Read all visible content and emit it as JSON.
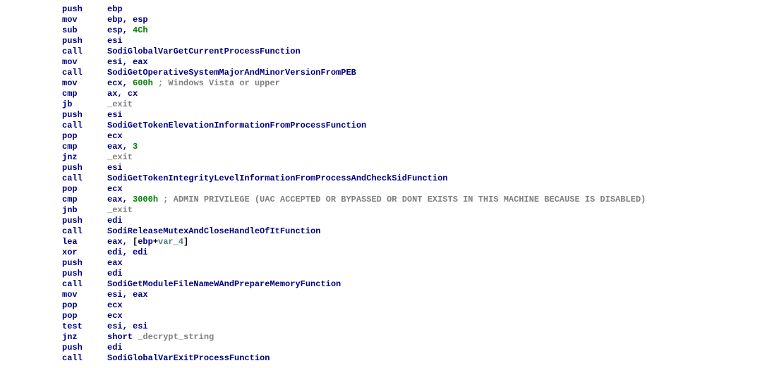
{
  "lines": [
    {
      "mn": "push",
      "ops": [
        {
          "t": "reg",
          "v": "ebp"
        }
      ]
    },
    {
      "mn": "mov",
      "ops": [
        {
          "t": "reg",
          "v": "ebp"
        },
        {
          "t": "reg",
          "v": "esp"
        }
      ]
    },
    {
      "mn": "sub",
      "ops": [
        {
          "t": "reg",
          "v": "esp"
        },
        {
          "t": "num",
          "v": "4Ch"
        }
      ]
    },
    {
      "mn": "push",
      "ops": [
        {
          "t": "reg",
          "v": "esi"
        }
      ]
    },
    {
      "mn": "call",
      "ops": [
        {
          "t": "reg",
          "v": "SodiGlobalVarGetCurrentProcessFunction"
        }
      ]
    },
    {
      "mn": "mov",
      "ops": [
        {
          "t": "reg",
          "v": "esi"
        },
        {
          "t": "reg",
          "v": "eax"
        }
      ]
    },
    {
      "mn": "call",
      "ops": [
        {
          "t": "reg",
          "v": "SodiGetOperativeSystemMajorAndMinorVersionFromPEB"
        }
      ]
    },
    {
      "mn": "mov",
      "ops": [
        {
          "t": "reg",
          "v": "ecx"
        },
        {
          "t": "num",
          "v": "600h"
        }
      ],
      "pad": "        ",
      "comment": "; Windows Vista or upper"
    },
    {
      "mn": "cmp",
      "ops": [
        {
          "t": "reg",
          "v": "ax"
        },
        {
          "t": "reg",
          "v": "cx"
        }
      ]
    },
    {
      "mn": "jb",
      "ops": [
        {
          "t": "lbl",
          "v": "_exit"
        }
      ]
    },
    {
      "mn": "push",
      "ops": [
        {
          "t": "reg",
          "v": "esi"
        }
      ]
    },
    {
      "mn": "call",
      "ops": [
        {
          "t": "reg",
          "v": "SodiGetTokenElevationInformationFromProcessFunction"
        }
      ]
    },
    {
      "mn": "pop",
      "ops": [
        {
          "t": "reg",
          "v": "ecx"
        }
      ]
    },
    {
      "mn": "cmp",
      "ops": [
        {
          "t": "reg",
          "v": "eax"
        },
        {
          "t": "num",
          "v": "3"
        }
      ]
    },
    {
      "mn": "jnz",
      "ops": [
        {
          "t": "lbl",
          "v": "_exit"
        }
      ]
    },
    {
      "mn": "push",
      "ops": [
        {
          "t": "reg",
          "v": "esi"
        }
      ]
    },
    {
      "mn": "call",
      "ops": [
        {
          "t": "reg",
          "v": "SodiGetTokenIntegrityLevelInformationFromProcessAndCheckSidFunction"
        }
      ]
    },
    {
      "mn": "pop",
      "ops": [
        {
          "t": "reg",
          "v": "ecx"
        }
      ]
    },
    {
      "mn": "cmp",
      "ops": [
        {
          "t": "reg",
          "v": "eax"
        },
        {
          "t": "num",
          "v": "3000h"
        }
      ],
      "pad": "       ",
      "comment": "; ADMIN PRIVILEGE (UAC ACCEPTED OR BYPASSED OR DONT EXISTS IN THIS MACHINE BECAUSE IS DISABLED)"
    },
    {
      "mn": "jnb",
      "ops": [
        {
          "t": "lbl",
          "v": "_exit"
        }
      ]
    },
    {
      "mn": "push",
      "ops": [
        {
          "t": "reg",
          "v": "edi"
        }
      ]
    },
    {
      "mn": "call",
      "ops": [
        {
          "t": "reg",
          "v": "SodiReleaseMutexAndCloseHandleOfItFunction"
        }
      ]
    },
    {
      "mn": "lea",
      "ops": [
        {
          "t": "reg",
          "v": "eax"
        },
        {
          "t": "mem",
          "parts": [
            {
              "t": "brk",
              "v": "["
            },
            {
              "t": "reg",
              "v": "ebp"
            },
            {
              "t": "brk",
              "v": "+"
            },
            {
              "t": "var",
              "v": "var_4"
            },
            {
              "t": "brk",
              "v": "]"
            }
          ]
        }
      ]
    },
    {
      "mn": "xor",
      "ops": [
        {
          "t": "reg",
          "v": "edi"
        },
        {
          "t": "reg",
          "v": "edi"
        }
      ]
    },
    {
      "mn": "push",
      "ops": [
        {
          "t": "reg",
          "v": "eax"
        }
      ]
    },
    {
      "mn": "push",
      "ops": [
        {
          "t": "reg",
          "v": "edi"
        }
      ]
    },
    {
      "mn": "call",
      "ops": [
        {
          "t": "reg",
          "v": "SodiGetModuleFileNameWAndPrepareMemoryFunction"
        }
      ]
    },
    {
      "mn": "mov",
      "ops": [
        {
          "t": "reg",
          "v": "esi"
        },
        {
          "t": "reg",
          "v": "eax"
        }
      ]
    },
    {
      "mn": "pop",
      "ops": [
        {
          "t": "reg",
          "v": "ecx"
        }
      ]
    },
    {
      "mn": "pop",
      "ops": [
        {
          "t": "reg",
          "v": "ecx"
        }
      ]
    },
    {
      "mn": "test",
      "ops": [
        {
          "t": "reg",
          "v": "esi"
        },
        {
          "t": "reg",
          "v": "esi"
        }
      ]
    },
    {
      "mn": "jnz",
      "ops": [
        {
          "t": "kw",
          "v": "short"
        },
        {
          "t": "lbl_sp",
          "v": "_decrypt_string"
        }
      ]
    },
    {
      "mn": "push",
      "ops": [
        {
          "t": "reg",
          "v": "edi"
        }
      ]
    },
    {
      "mn": "call",
      "ops": [
        {
          "t": "reg",
          "v": "SodiGlobalVarExitProcessFunction"
        }
      ]
    }
  ]
}
